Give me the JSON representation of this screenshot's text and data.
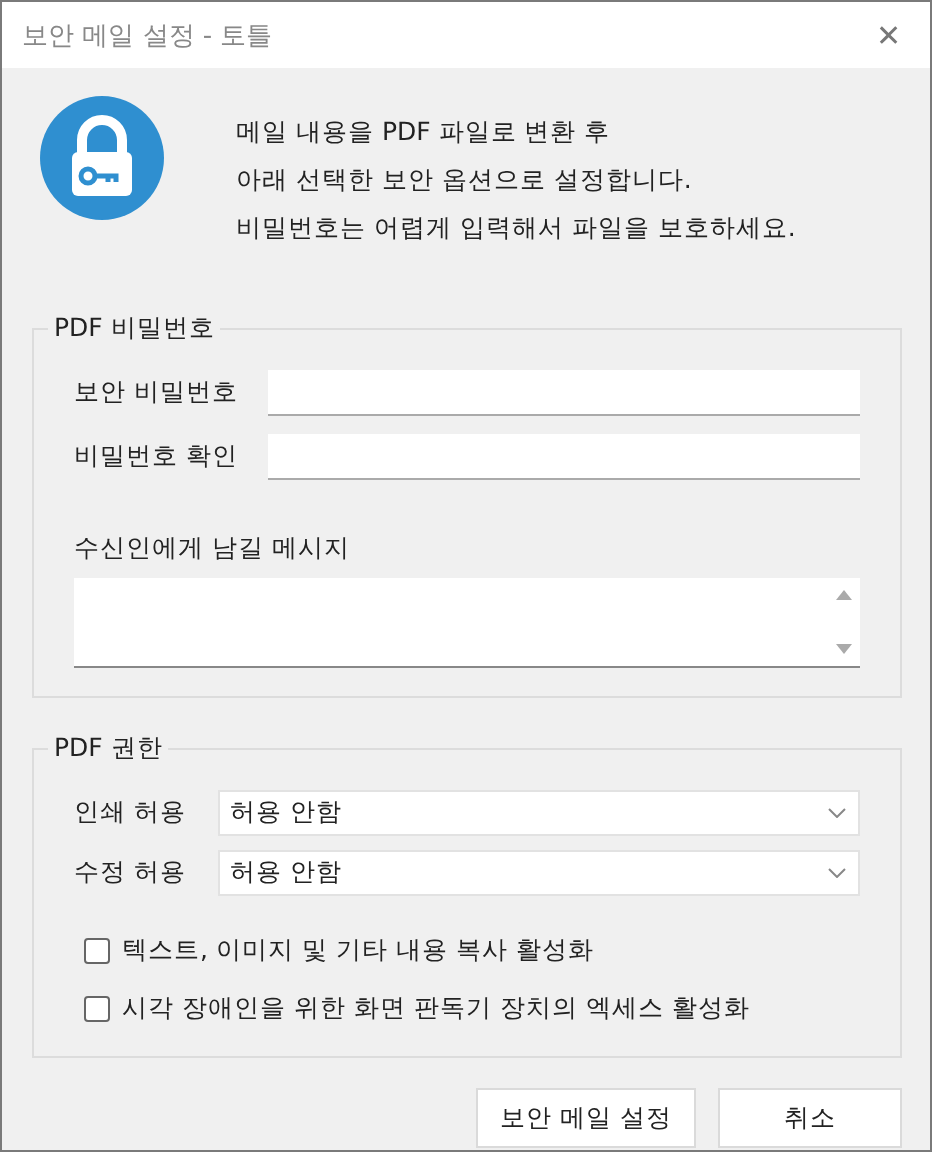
{
  "window": {
    "title": "보안 메일 설정 - 토틀",
    "close": "✕"
  },
  "intro": [
    "메일 내용을 PDF 파일로 변환 후",
    "아래 선택한 보안 옵션으로 설정합니다.",
    "비밀번호는 어렵게 입력해서 파일을 보호하세요."
  ],
  "password_group": {
    "title": "PDF 비밀번호",
    "fields": [
      {
        "label": "보안 비밀번호"
      },
      {
        "label": "비밀번호 확인"
      }
    ],
    "message": {
      "label": "수신인에게 남길 메시지"
    }
  },
  "permissions_group": {
    "title": "PDF 권한",
    "selects": [
      {
        "label": "인쇄 허용",
        "value": "허용 안함"
      },
      {
        "label": "수정 허용",
        "value": "허용 안함"
      }
    ],
    "checkboxes": [
      {
        "label": "텍스트, 이미지 및 기타 내용 복사 활성화",
        "checked": false
      },
      {
        "label": "시각 장애인을 위한 화면 판독기 장치의 엑세스 활성화",
        "checked": false
      }
    ]
  },
  "buttons": [
    "보안 메일 설정",
    "취소"
  ]
}
